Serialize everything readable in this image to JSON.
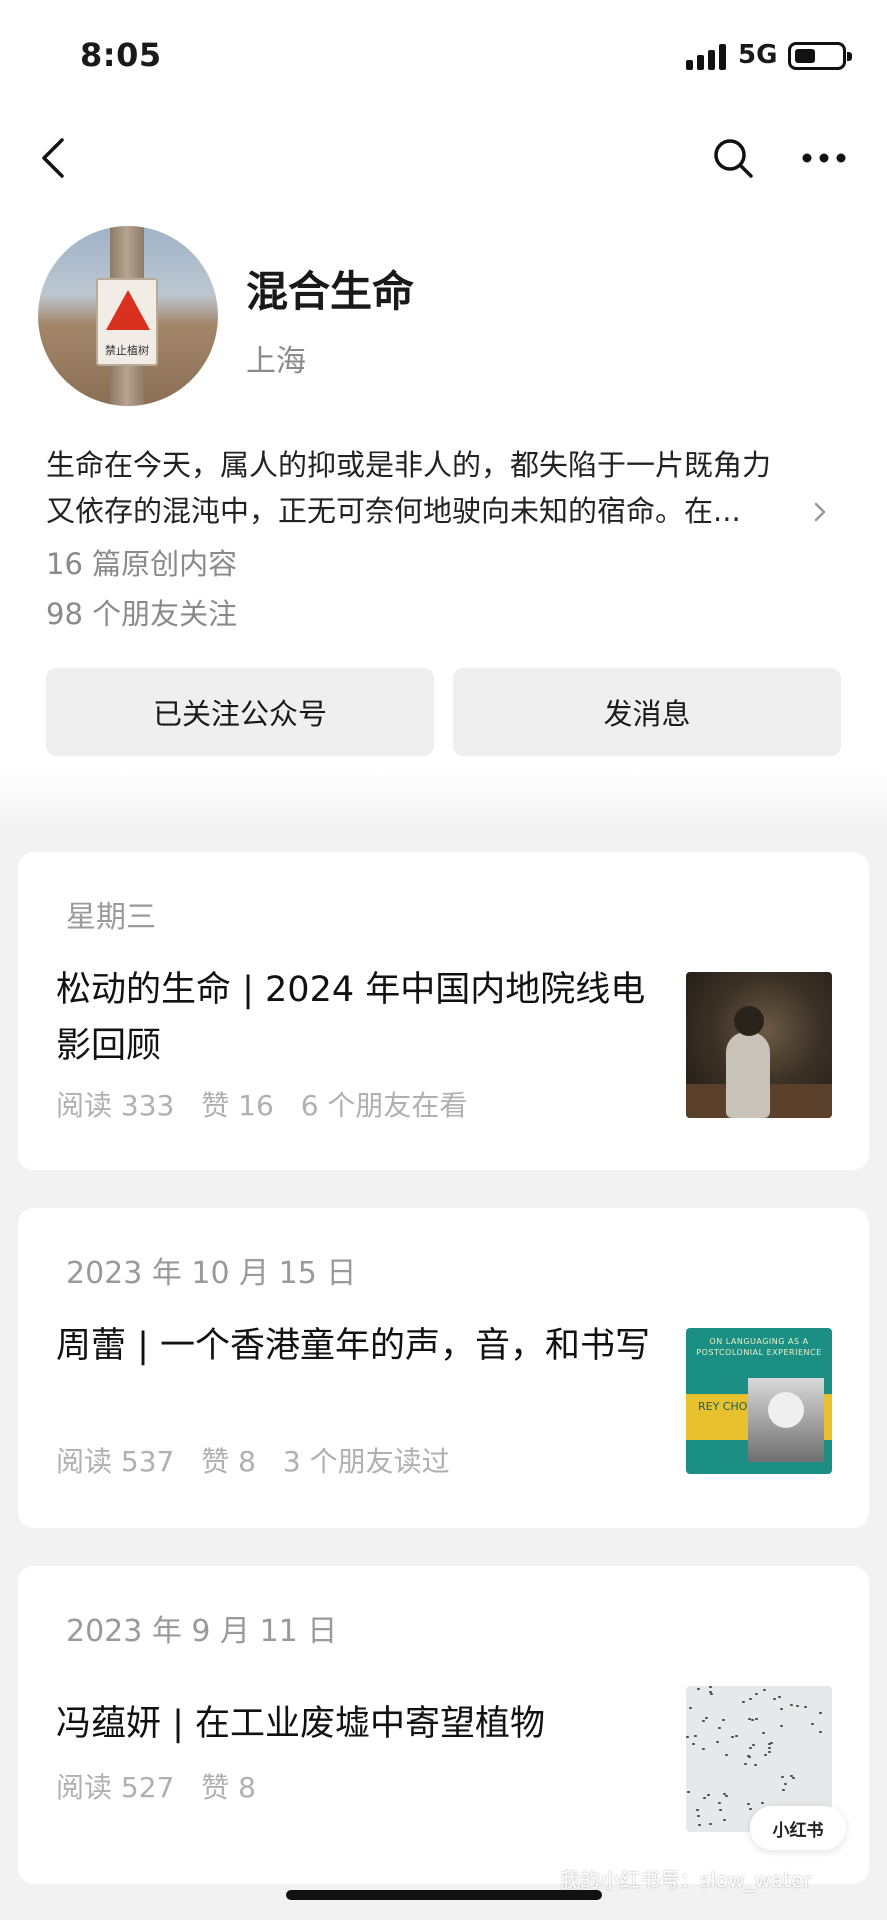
{
  "status_bar": {
    "time": "8:05",
    "network": "5G"
  },
  "nav": {
    "back_icon": "chevron-left-icon",
    "search_icon": "search-icon",
    "more_icon": "more-dots-icon"
  },
  "profile": {
    "name": "混合生命",
    "location": "上海",
    "avatar_sign_text": "禁止植树",
    "bio_line1": "生命在今天，属人的抑或是非人的，都失陷于一片既角力",
    "bio_line2": "又依存的混沌中，正无可奈何地驶向未知的宿命。在...",
    "articles_count": "16 篇原创内容",
    "followers": "98 个朋友关注"
  },
  "actions": {
    "follow_label": "已关注公众号",
    "message_label": "发消息"
  },
  "articles": [
    {
      "date": "星期三",
      "title": "松动的生命 | 2024 年中国内地院线电影回顾",
      "reads": "阅读 333",
      "likes": "赞 16",
      "friends": "6 个朋友在看"
    },
    {
      "date": "2023 年 10 月 15 日",
      "title": "周蕾 | 一个香港童年的声，音，和书写",
      "reads": "阅读 537",
      "likes": "赞 8",
      "friends": "3 个朋友读过",
      "thumb_book_title": "ON LANGUAGING AS A POSTCOLONIAL EXPERIENCE",
      "thumb_book_author": "REY CHOW"
    },
    {
      "date": "2023 年 9 月 11 日",
      "title": "冯蕴妍 | 在工业废墟中寄望植物",
      "reads": "阅读 527",
      "likes": "赞 8"
    }
  ],
  "overlay": {
    "badge": "小红书",
    "watermark": "我的小红书号：slow_water"
  }
}
